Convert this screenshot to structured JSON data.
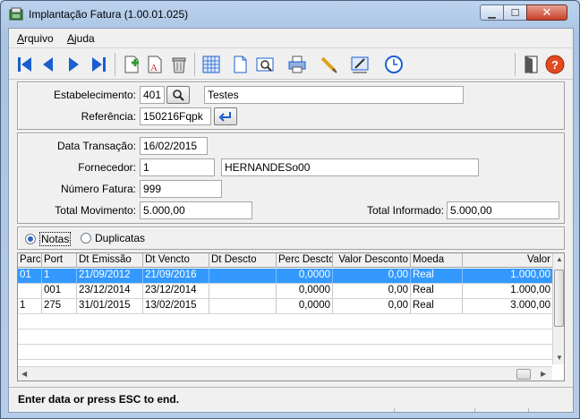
{
  "window": {
    "title": "Implantação Fatura (1.00.01.025)"
  },
  "menu": [
    {
      "label": "Arquivo",
      "accel": "A",
      "rest": "rquivo"
    },
    {
      "label": "Ajuda",
      "accel": "A",
      "rest": "juda"
    }
  ],
  "toolbar": {
    "icons": [
      "first-record-icon",
      "previous-record-icon",
      "next-record-icon",
      "last-record-icon",
      "new-record-icon",
      "edit-record-icon",
      "delete-icon",
      "calculator-icon",
      "document-icon",
      "preview-icon",
      "print-icon",
      "pencil-icon",
      "sign-off-icon",
      "clock-icon",
      "exit-door-icon",
      "help-icon"
    ]
  },
  "header_panel": {
    "estabelecimento_label": "Estabelecimento:",
    "estabelecimento_value": "401",
    "estabelecimento_desc": "Testes",
    "referencia_label": "Referência:",
    "referencia_value": "150216Fqpk"
  },
  "details_panel": {
    "data_transacao_label": "Data Transação:",
    "data_transacao_value": "16/02/2015",
    "fornecedor_label": "Fornecedor:",
    "fornecedor_code": "1",
    "fornecedor_name": "HERNANDESo00",
    "numero_fatura_label": "Número  Fatura:",
    "numero_fatura_value": "999",
    "total_movimento_label": "Total  Movimento:",
    "total_movimento_value": "5.000,00",
    "total_informado_label": "Total Informado:",
    "total_informado_value": "5.000,00"
  },
  "view_options": {
    "notas": "Notas",
    "duplicatas": "Duplicatas",
    "selected": "Notas"
  },
  "grid": {
    "columns": [
      "Parc",
      "Port",
      "Dt Emissão",
      "Dt Vencto",
      "Dt Descto",
      "Perc Descto",
      "Valor Desconto",
      "Moeda",
      "Valor"
    ],
    "rows": [
      [
        "01",
        "1",
        "21/09/2012",
        "21/09/2016",
        "",
        "0,0000",
        "0,00",
        "Real",
        "1.000,00"
      ],
      [
        "",
        "001",
        "23/12/2014",
        "23/12/2014",
        "",
        "0,0000",
        "0,00",
        "Real",
        "1.000,00"
      ],
      [
        "1",
        "275",
        "31/01/2015",
        "13/02/2015",
        "",
        "0,0000",
        "0,00",
        "Real",
        "3.000,00"
      ]
    ],
    "selected_row": 0
  },
  "status": {
    "text": "Enter data or press ESC to end."
  },
  "colors": {
    "selection": "#3399ff",
    "close_button": "#c7402a",
    "toolbar_blue": "#1a5fd0"
  }
}
